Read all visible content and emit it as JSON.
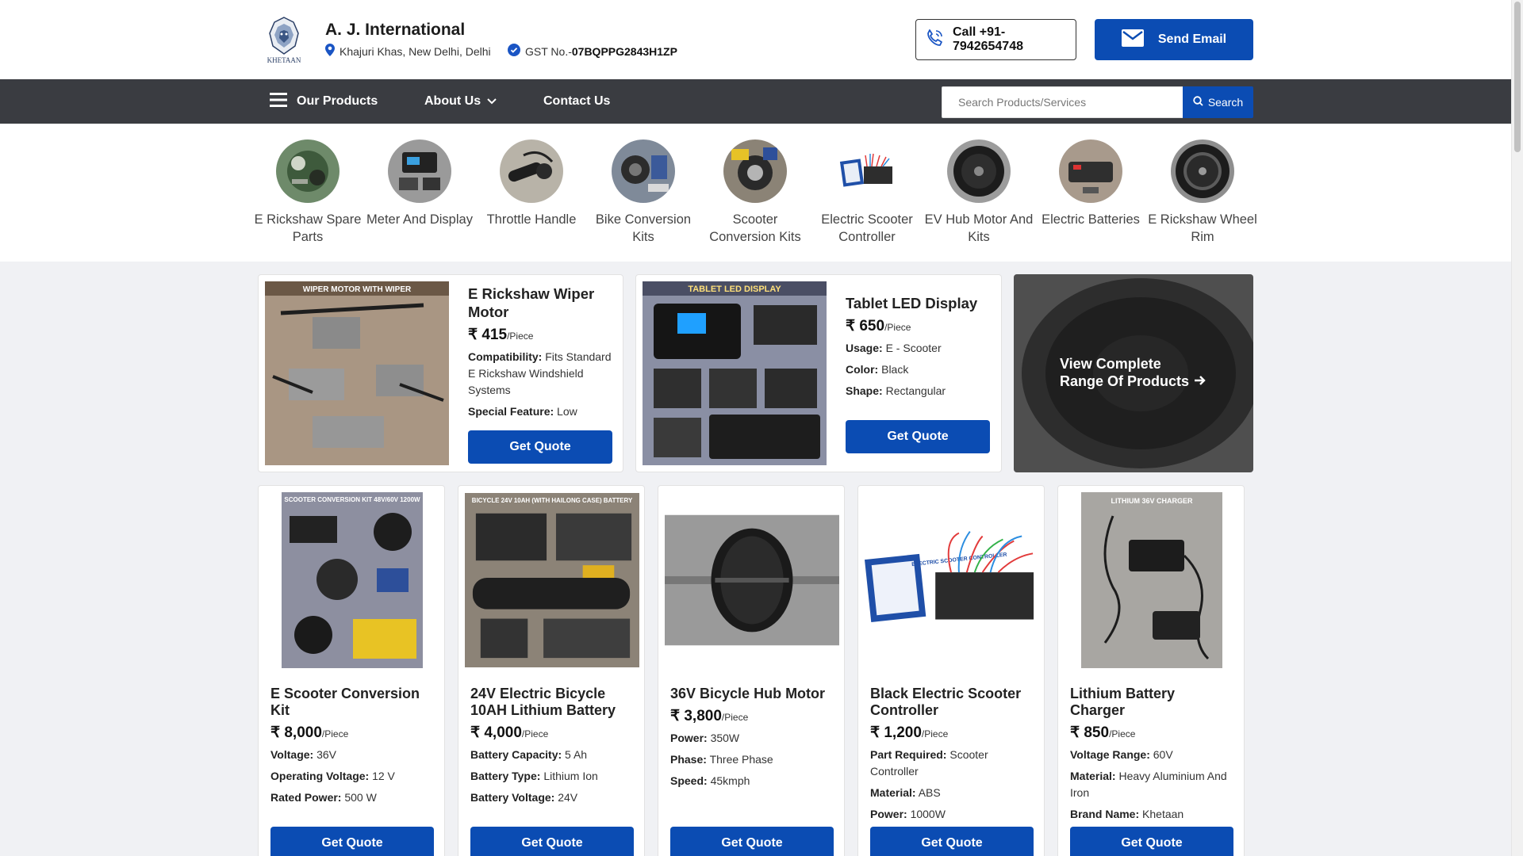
{
  "header": {
    "company_name": "A. J. International",
    "logo_text": "KHETAAN",
    "address": "Khajuri Khas, New Delhi, Delhi",
    "gst_label": "GST No.-",
    "gst_number": "07BQPPG2843H1ZP",
    "call_label": "Call +91-7942654748",
    "email_label": "Send Email"
  },
  "nav": {
    "products": "Our Products",
    "about": "About Us",
    "contact": "Contact Us",
    "search_placeholder": "Search Products/Services",
    "search_label": "Search"
  },
  "categories": [
    {
      "label": "E Rickshaw Spare Parts"
    },
    {
      "label": "Meter And Display"
    },
    {
      "label": "Throttle Handle"
    },
    {
      "label": "Bike Conversion Kits"
    },
    {
      "label": "Scooter Conversion Kits"
    },
    {
      "label": "Electric Scooter Controller"
    },
    {
      "label": "EV Hub Motor And Kits"
    },
    {
      "label": "Electric Batteries"
    },
    {
      "label": "E Rickshaw Wheel Rim"
    }
  ],
  "featured": [
    {
      "image_caption": "WIPER MOTOR WITH WIPER",
      "title": "E Rickshaw Wiper Motor",
      "price": "₹ 415",
      "unit": "/Piece",
      "specs": [
        {
          "k": "Compatibility:",
          "v": "Fits Standard E Rickshaw Windshield Systems"
        },
        {
          "k": "Special Feature:",
          "v": "Low"
        }
      ],
      "quote": "Get Quote"
    },
    {
      "image_caption": "TABLET LED DISPLAY",
      "title": "Tablet LED Display",
      "price": "₹ 650",
      "unit": "/Piece",
      "specs": [
        {
          "k": "Usage:",
          "v": "E - Scooter"
        },
        {
          "k": "Color:",
          "v": "Black"
        },
        {
          "k": "Shape:",
          "v": "Rectangular"
        }
      ],
      "quote": "Get Quote"
    }
  ],
  "view_all": {
    "line1": "View Complete",
    "line2": "Range Of Products"
  },
  "products": [
    {
      "image_caption": "SCOOTER CONVERSION KIT 48V/60V 1200W",
      "title": "E Scooter Conversion Kit",
      "price": "₹ 8,000",
      "unit": "/Piece",
      "specs": [
        {
          "k": "Voltage:",
          "v": "36V"
        },
        {
          "k": "Operating Voltage:",
          "v": "12 V"
        },
        {
          "k": "Rated Power:",
          "v": "500 W"
        }
      ],
      "quote": "Get Quote"
    },
    {
      "image_caption": "BICYCLE 24V 10AH (WITH HAILONG CASE) BATTERY",
      "title": "24V Electric Bicycle 10AH Lithium Battery",
      "price": "₹ 4,000",
      "unit": "/Piece",
      "specs": [
        {
          "k": "Battery Capacity:",
          "v": "5 Ah"
        },
        {
          "k": "Battery Type:",
          "v": "Lithium Ion"
        },
        {
          "k": "Battery Voltage:",
          "v": "24V"
        }
      ],
      "quote": "Get Quote"
    },
    {
      "image_caption": "",
      "title": "36V Bicycle Hub Motor",
      "price": "₹ 3,800",
      "unit": "/Piece",
      "specs": [
        {
          "k": "Power:",
          "v": "350W"
        },
        {
          "k": "Phase:",
          "v": "Three Phase"
        },
        {
          "k": "Speed:",
          "v": "45kmph"
        }
      ],
      "quote": "Get Quote"
    },
    {
      "image_caption": "ELECTRIC SCOOTER CONTROLLER",
      "title": "Black Electric Scooter Controller",
      "price": "₹ 1,200",
      "unit": "/Piece",
      "specs": [
        {
          "k": "Part Required:",
          "v": "Scooter Controller"
        },
        {
          "k": "Material:",
          "v": "ABS"
        },
        {
          "k": "Power:",
          "v": "1000W"
        }
      ],
      "quote": "Get Quote"
    },
    {
      "image_caption": "LITHIUM 36V CHARGER",
      "title": "Lithium Battery Charger",
      "price": "₹ 850",
      "unit": "/Piece",
      "specs": [
        {
          "k": "Voltage Range:",
          "v": "60V"
        },
        {
          "k": "Material:",
          "v": "Heavy Aluminium And Iron"
        },
        {
          "k": "Brand Name:",
          "v": "Khetaan"
        }
      ],
      "quote": "Get Quote"
    }
  ],
  "colors": {
    "primary": "#0b4cb3",
    "nav_bg": "#3a3c41",
    "page_bg": "#f0f1f4"
  }
}
